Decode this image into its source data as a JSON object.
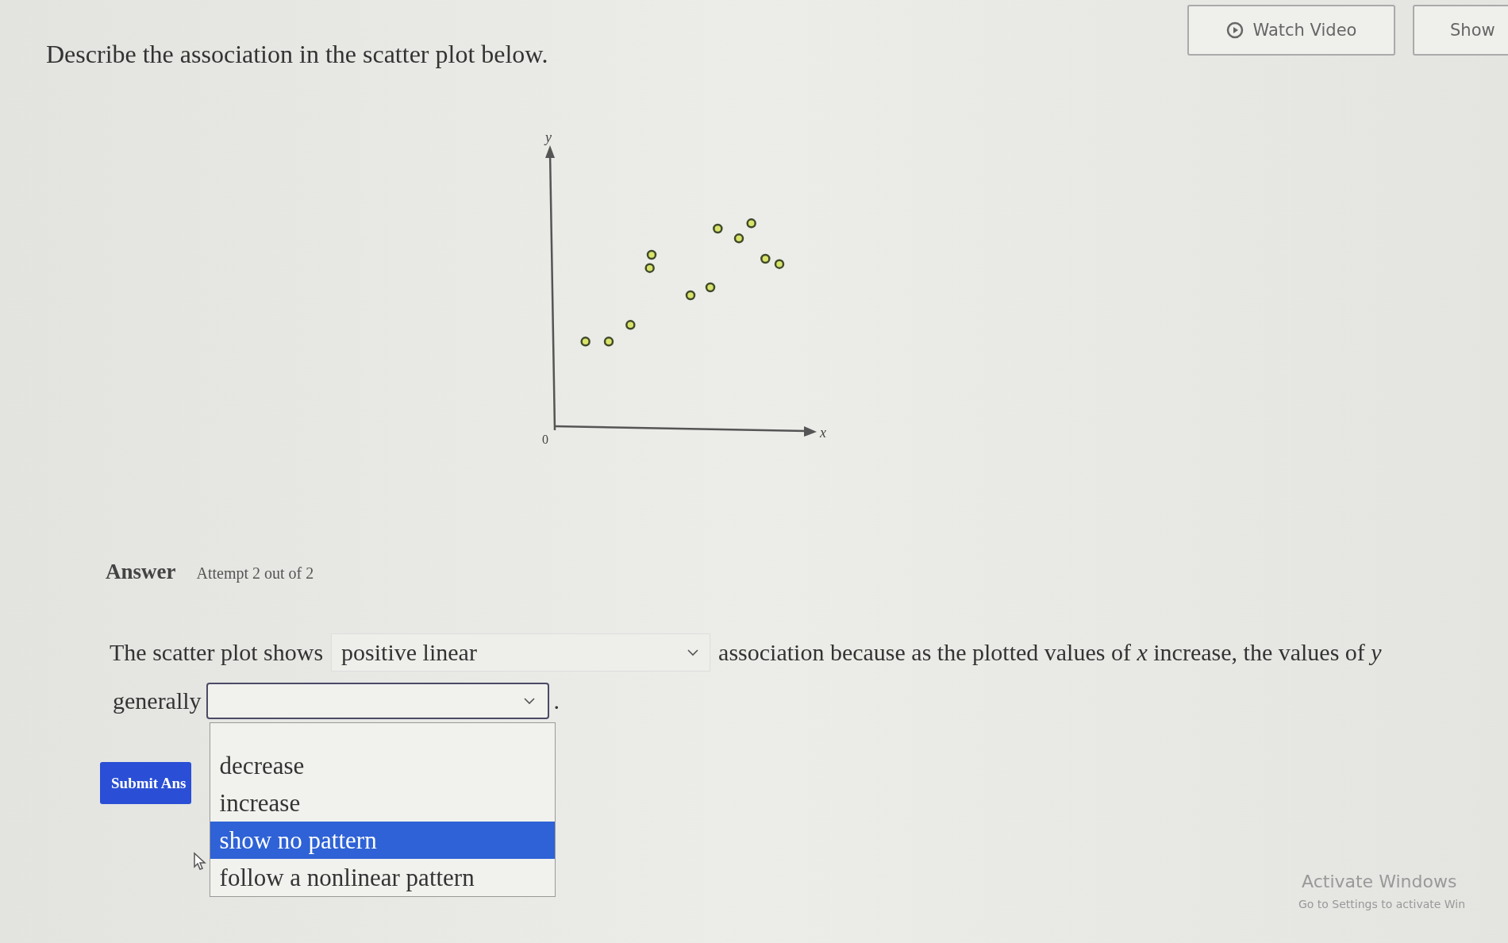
{
  "header_buttons": [
    {
      "kind": "video",
      "label": "Watch Video"
    },
    {
      "kind": "plain",
      "label": "Show"
    }
  ],
  "question": "Describe the association in the scatter plot below.",
  "plot": {
    "y_label": "y",
    "x_label": "x",
    "origin_label": "0"
  },
  "answer": {
    "title": "Answer",
    "attempt": "Attempt 2 out of 2"
  },
  "sentence": {
    "lead": "The scatter plot shows",
    "select_1": {
      "value": "positive linear"
    },
    "middle": "association because as the plotted values of *x* increase, the values of *y*",
    "lead_2": "generally",
    "select_2": {
      "expanded": true,
      "options": [
        {
          "label": "decrease",
          "selected": false
        },
        {
          "label": "increase",
          "selected": false
        },
        {
          "label": "show no pattern",
          "selected": true
        },
        {
          "label": "follow a nonlinear pattern",
          "selected": false
        }
      ]
    },
    "end": "."
  },
  "submit_button": "Submit Ans",
  "os_notice": {
    "title": "Activate Windows",
    "subtitle": "Go to Settings to activate Win"
  }
}
